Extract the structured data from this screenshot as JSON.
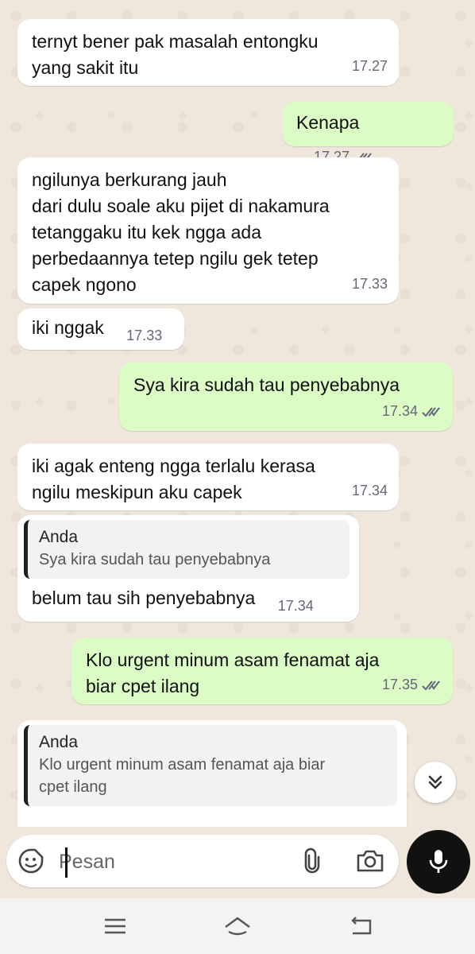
{
  "messages": [
    {
      "dir": "in",
      "text": "ternyt bener pak masalah entongku\nyang sakit itu",
      "time": "17.27"
    },
    {
      "dir": "out",
      "text": "Kenapa",
      "time": "17.27"
    },
    {
      "dir": "in",
      "text": "ngilunya berkurang jauh\ndari dulu soale aku pijet di nakamura\ntetanggaku itu kek ngga ada\nperbedaannya tetep ngilu gek tetep\ncapek ngono",
      "time": "17.33"
    },
    {
      "dir": "in",
      "text": "iki nggak",
      "time": "17.33"
    },
    {
      "dir": "out",
      "text": "Sya kira sudah tau penyebabnya",
      "time": "17.34"
    },
    {
      "dir": "in",
      "text": "iki agak enteng ngga terlalu kerasa\nngilu meskipun aku capek",
      "time": "17.34"
    },
    {
      "dir": "in",
      "quote_name": "Anda",
      "quote_text": "Sya kira sudah tau penyebabnya",
      "text": "belum tau sih penyebabnya",
      "time": "17.34"
    },
    {
      "dir": "out",
      "text": "Klo urgent minum asam fenamat aja\nbiar cpet ilang",
      "time": "17.35"
    },
    {
      "dir": "in",
      "quote_name": "Anda",
      "quote_text": "Klo urgent minum asam fenamat aja biar\ncpet ilang",
      "text": "",
      "time": ""
    }
  ],
  "input": {
    "placeholder": "Pesan"
  },
  "icons": {
    "emoji": "sticker-icon",
    "attach": "paperclip-icon",
    "camera": "camera-icon",
    "mic": "microphone-icon",
    "scroll": "double-chevron-down-icon",
    "read": "double-check-icon"
  },
  "colors": {
    "incoming": "#ffffff",
    "outgoing": "#dcfcc6",
    "background": "#efe7dc",
    "mic": "#111111"
  }
}
